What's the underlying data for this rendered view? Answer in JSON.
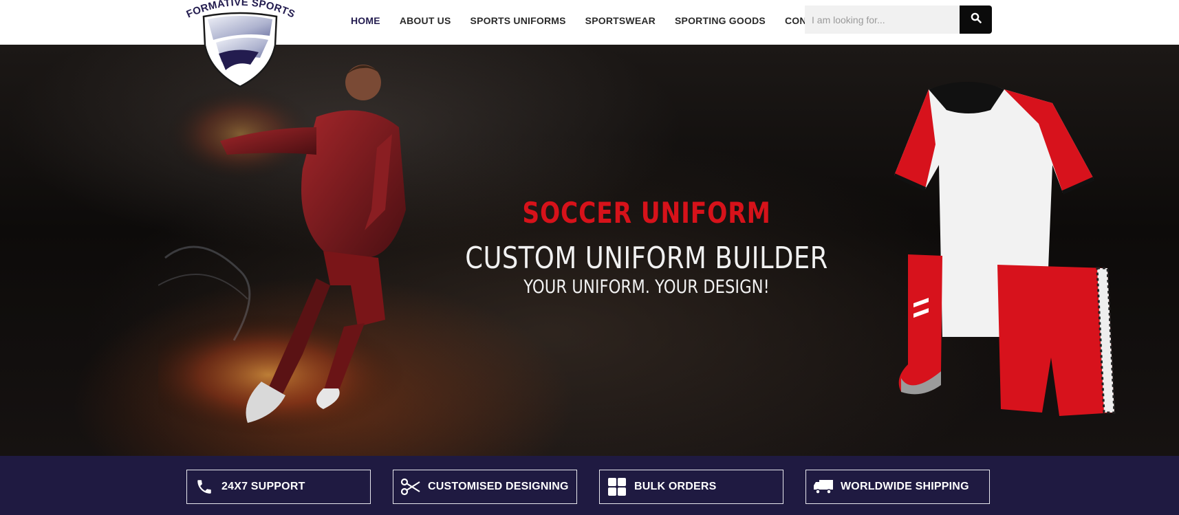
{
  "brand": {
    "name": "FORMATIVE SPORTS",
    "colors": {
      "navy": "#231c4f",
      "red": "#d6121a",
      "bar": "#1f1a41"
    }
  },
  "nav": {
    "items": [
      {
        "label": "HOME",
        "active": true
      },
      {
        "label": "ABOUT US",
        "active": false
      },
      {
        "label": "SPORTS UNIFORMS",
        "active": false
      },
      {
        "label": "SPORTSWEAR",
        "active": false
      },
      {
        "label": "SPORTING GOODS",
        "active": false
      },
      {
        "label": "CONTACT",
        "active": false
      }
    ]
  },
  "search": {
    "placeholder": "I am looking for...",
    "value": "",
    "icon": "search-icon"
  },
  "hero": {
    "title": "SOCCER UNIFORM",
    "subtitle": "CUSTOM UNIFORM BUILDER",
    "tagline": "YOUR UNIFORM. YOUR DESIGN!"
  },
  "features": [
    {
      "label": "24X7 SUPPORT",
      "icon": "phone-icon"
    },
    {
      "label": "CUSTOMISED DESIGNING",
      "icon": "scissors-icon"
    },
    {
      "label": "BULK ORDERS",
      "icon": "grid-icon"
    },
    {
      "label": "WORLDWIDE SHIPPING",
      "icon": "truck-icon"
    }
  ]
}
